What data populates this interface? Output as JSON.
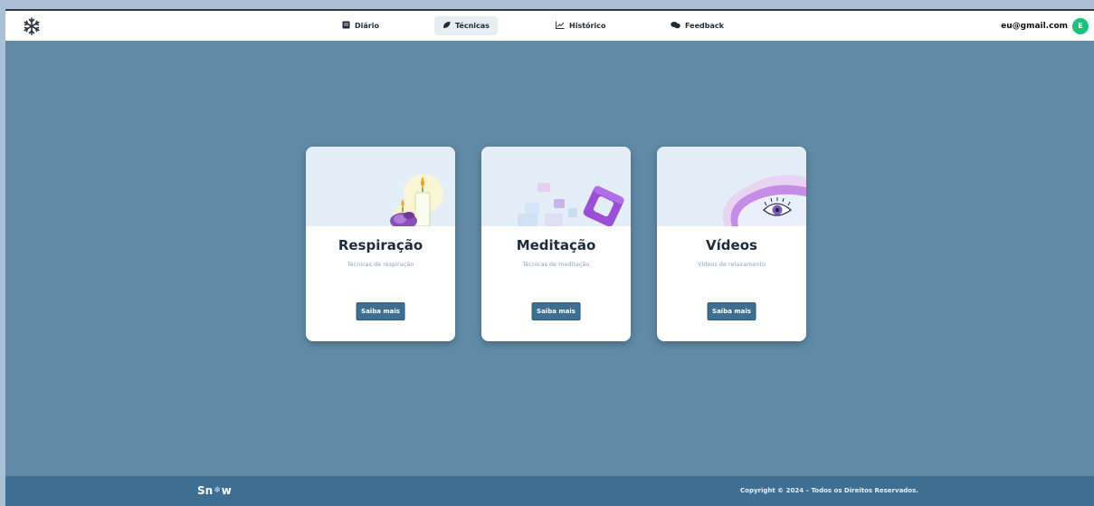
{
  "nav": {
    "brand_icon": "snowflake-icon",
    "items": [
      {
        "label": "Diário",
        "icon": "book-icon"
      },
      {
        "label": "Técnicas",
        "icon": "leaf-icon",
        "active": true
      },
      {
        "label": "Histórico",
        "icon": "chart-line-icon"
      },
      {
        "label": "Feedback",
        "icon": "chat-bubbles-icon"
      }
    ],
    "user_email": "eu@gmail.com",
    "avatar_initial": "E"
  },
  "cards": [
    {
      "title": "Respiração",
      "subtitle": "Técnicas de respiração",
      "button": "Saiba mais",
      "illustration": "candles-illustration"
    },
    {
      "title": "Meditação",
      "subtitle": "Técnicas de meditação",
      "button": "Saiba mais",
      "illustration": "shapes-illustration"
    },
    {
      "title": "Vídeos",
      "subtitle": "Vídeos de relaxamento",
      "button": "Saiba mais",
      "illustration": "eye-illustration"
    }
  ],
  "footer": {
    "logo_left": "Sn",
    "logo_right": "w",
    "copyright": "Copyright © 2024 – Todos os Direitos Reservados."
  },
  "colors": {
    "background": "#628aa6",
    "navbar": "#ffffff",
    "footer": "#3e6f93",
    "button": "#3e6f93",
    "card_hero": "#e4eef9",
    "avatar": "#1fc27a"
  }
}
